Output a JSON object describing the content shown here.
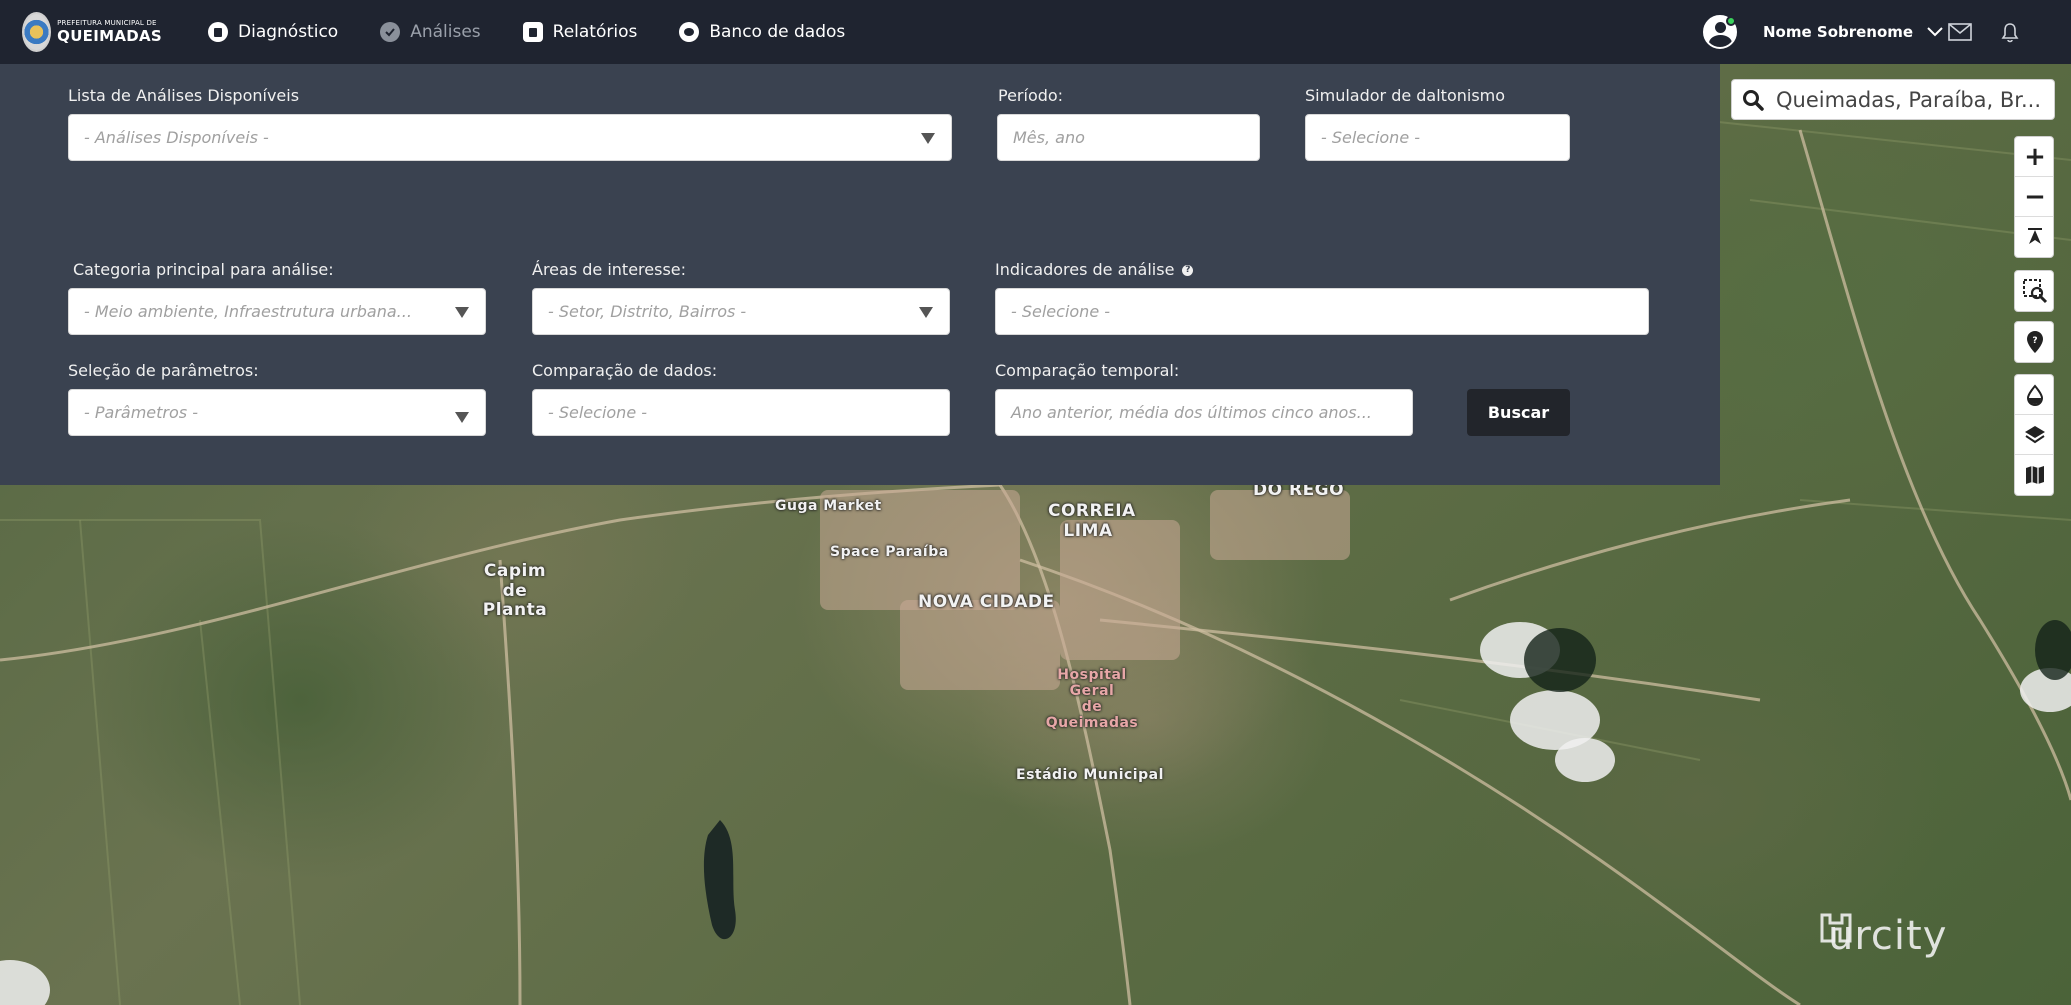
{
  "header": {
    "logo": {
      "line1": "PREFEITURA MUNICIPAL DE",
      "line2": "QUEIMADAS",
      "icon": "city-seal-icon"
    },
    "nav": [
      {
        "label": "Diagnóstico",
        "icon": "diagnostico-icon",
        "active": true
      },
      {
        "label": "Análises",
        "icon": "analises-icon",
        "active": false
      },
      {
        "label": "Relatórios",
        "icon": "relatorios-icon",
        "active": true
      },
      {
        "label": "Banco de dados",
        "icon": "database-icon",
        "active": true
      }
    ],
    "user": {
      "name": "Nome  Sobrenome",
      "status_color": "#3ad15b"
    },
    "icons": [
      "user-avatar-icon",
      "chevron-down-icon",
      "mail-icon",
      "bell-icon"
    ]
  },
  "filters": {
    "analysis_list": {
      "label": "Lista de Análises Disponíveis",
      "placeholder": "- Análises Disponíveis -"
    },
    "period": {
      "label": "Período:",
      "placeholder": "Mês, ano"
    },
    "color_blind": {
      "label": "Simulador de daltonismo",
      "placeholder": "- Selecione -"
    },
    "category": {
      "label": "Categoria principal para análise:",
      "placeholder": "- Meio ambiente, Infraestrutura urbana..."
    },
    "areas": {
      "label": "Áreas de interesse:",
      "placeholder": "- Setor, Distrito, Bairros -"
    },
    "indicators": {
      "label": "Indicadores de análise",
      "placeholder": "- Selecione -",
      "help": "?"
    },
    "parameters": {
      "label": "Seleção de parâmetros:",
      "placeholder": "- Parâmetros -"
    },
    "comparison": {
      "label": "Comparação de dados:",
      "placeholder": "- Selecione -"
    },
    "temporal": {
      "label": "Comparação temporal:",
      "placeholder": "Ano anterior, média dos últimos cinco anos..."
    },
    "search_button": "Buscar"
  },
  "map": {
    "search_text": "Queimadas, Paraíba, Br...",
    "controls": {
      "zoom_in": "+",
      "zoom_out": "−",
      "icons": [
        "zoom-in-icon",
        "zoom-out-icon",
        "compass-north-icon",
        "zoom-area-icon",
        "location-pin-icon",
        "drop-icon",
        "layers-icon",
        "map-icon"
      ]
    },
    "labels": {
      "guga_market": "Guga Market",
      "correia_lima_1": "CORREIA",
      "correia_lima_2": "LIMA",
      "do_rego": "DO REGO",
      "space_paraiba": "Space Paraíba",
      "capim_1": "Capim de",
      "capim_2": "Planta",
      "nova_cidade": "NOVA CIDADE",
      "hospital_1": "Hospital Geral",
      "hospital_2": "de Queimadas",
      "estadio": "Estádio Municipal"
    },
    "brand": "urcity"
  },
  "colors": {
    "topbar": "#1f2430",
    "panel": "#3a4250",
    "button": "#22252b"
  }
}
